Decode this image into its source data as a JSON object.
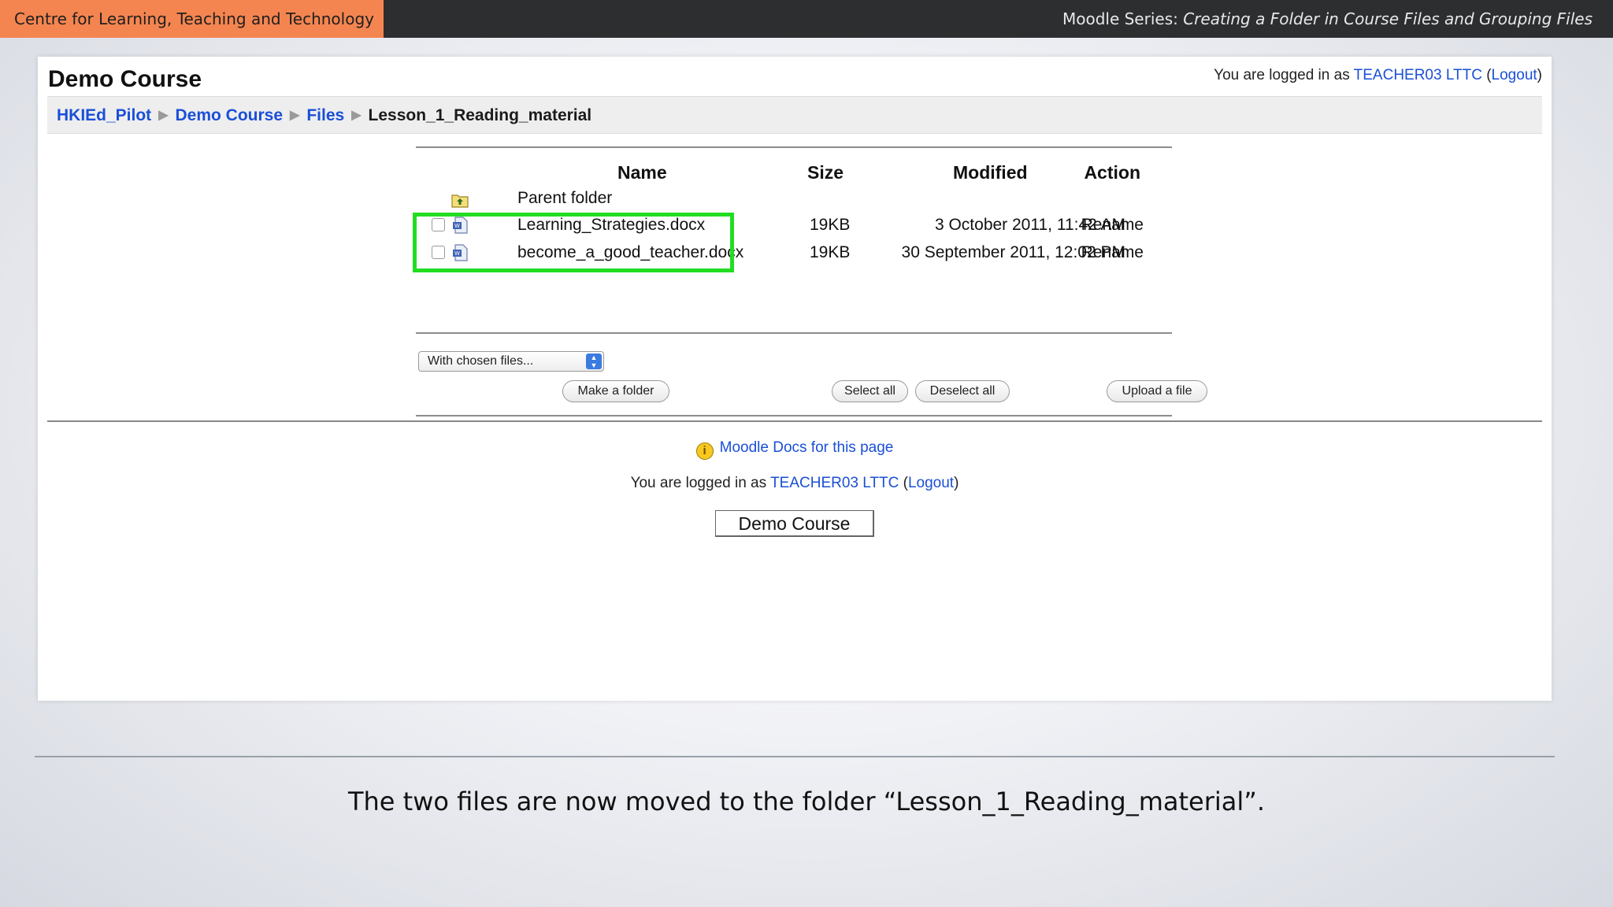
{
  "topbar": {
    "org": "Centre for Learning, Teaching and Technology",
    "series_prefix": "Moodle Series: ",
    "series_title": "Creating a Folder in Course Files and Grouping Files",
    "org_color": "#f58550"
  },
  "header": {
    "course_title": "Demo Course",
    "login_prefix": "You are logged in as ",
    "user": "TEACHER03 LTTC",
    "logout": "Logout"
  },
  "breadcrumb": [
    "HKIEd_Pilot",
    "Demo Course",
    "Files",
    "Lesson_1_Reading_material"
  ],
  "table": {
    "headers": {
      "name": "Name",
      "size": "Size",
      "modified": "Modified",
      "action": "Action"
    },
    "parent_folder": "Parent folder",
    "rows": [
      {
        "name": "Learning_Strategies.docx",
        "size": "19KB",
        "modified": "3 October 2011, 11:42 AM",
        "action": "Rename"
      },
      {
        "name": "become_a_good_teacher.docx",
        "size": "19KB",
        "modified": "30 September 2011, 12:02 PM",
        "action": "Rename"
      }
    ]
  },
  "controls": {
    "with_chosen": "With chosen files...",
    "make_folder": "Make a folder",
    "select_all": "Select all",
    "deselect_all": "Deselect all",
    "upload": "Upload a file"
  },
  "footer": {
    "docs_link": "Moodle Docs for this page",
    "login_prefix": "You are logged in as ",
    "user": "TEACHER03 LTTC",
    "logout": "Logout",
    "course_button": "Demo Course"
  },
  "caption": "The two files are now moved to the folder “Lesson_1_Reading_material”.",
  "colors": {
    "link": "#1a4fd6",
    "highlight": "#22dd22"
  }
}
